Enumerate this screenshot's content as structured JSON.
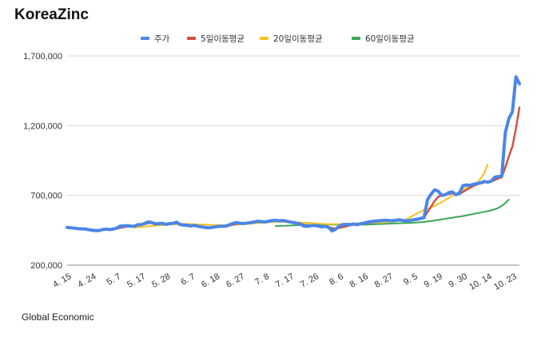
{
  "header": {
    "title": "KoreaZinc"
  },
  "footer": {
    "source": "Global Economic"
  },
  "colors": {
    "price": "#4a86e8",
    "ma5": "#d44b3f",
    "ma20": "#f4c21c",
    "ma60": "#3aa655",
    "grid": "#d9d9d9"
  },
  "chart_data": {
    "type": "line",
    "title": "KoreaZinc",
    "xlabel": "",
    "ylabel": "",
    "ylim": [
      200000,
      1700000
    ],
    "yticks": [
      200000,
      700000,
      1200000,
      1700000
    ],
    "ytick_labels": [
      "200,000",
      "700,000",
      "1,200,000",
      "1,700,000"
    ],
    "xticks": [
      {
        "i": 0,
        "label": "4. 15"
      },
      {
        "i": 7,
        "label": "4. 24"
      },
      {
        "i": 14,
        "label": "5. 7"
      },
      {
        "i": 21,
        "label": "5. 17"
      },
      {
        "i": 28,
        "label": "5. 28"
      },
      {
        "i": 35,
        "label": "6. 7"
      },
      {
        "i": 42,
        "label": "6. 18"
      },
      {
        "i": 49,
        "label": "6. 27"
      },
      {
        "i": 56,
        "label": "7. 8"
      },
      {
        "i": 63,
        "label": "7. 17"
      },
      {
        "i": 70,
        "label": "7. 26"
      },
      {
        "i": 77,
        "label": "8. 6"
      },
      {
        "i": 84,
        "label": "8. 16"
      },
      {
        "i": 91,
        "label": "8. 27"
      },
      {
        "i": 98,
        "label": "9. 5"
      },
      {
        "i": 105,
        "label": "9. 19"
      },
      {
        "i": 112,
        "label": "9. 30"
      },
      {
        "i": 119,
        "label": "10. 14"
      },
      {
        "i": 126,
        "label": "10. 23"
      }
    ],
    "legend_position": "top",
    "grid": true,
    "series": [
      {
        "name": "주가",
        "color": "#4a86e8",
        "start": 0,
        "width": 4,
        "values": [
          470000,
          468000,
          465000,
          462000,
          460000,
          460000,
          455000,
          450000,
          448000,
          448000,
          455000,
          458000,
          455000,
          458000,
          465000,
          480000,
          482000,
          483000,
          480000,
          478000,
          490000,
          490000,
          500000,
          510000,
          505000,
          495000,
          498000,
          500000,
          492000,
          498000,
          500000,
          508000,
          490000,
          487000,
          485000,
          480000,
          485000,
          478000,
          475000,
          470000,
          468000,
          470000,
          475000,
          478000,
          478000,
          480000,
          490000,
          500000,
          505000,
          500000,
          498000,
          502000,
          505000,
          510000,
          515000,
          512000,
          510000,
          515000,
          520000,
          522000,
          518000,
          520000,
          515000,
          510000,
          505000,
          500000,
          495000,
          480000,
          478000,
          482000,
          485000,
          480000,
          475000,
          478000,
          470000,
          445000,
          458000,
          480000,
          490000,
          492000,
          490000,
          495000,
          490000,
          496000,
          502000,
          508000,
          512000,
          515000,
          518000,
          520000,
          522000,
          520000,
          518000,
          522000,
          525000,
          520000,
          518000,
          520000,
          525000,
          530000,
          535000,
          540000,
          670000,
          710000,
          740000,
          730000,
          700000,
          705000,
          720000,
          725000,
          705000,
          715000,
          770000,
          775000,
          772000,
          780000,
          785000,
          790000,
          800000,
          795000,
          802000,
          830000,
          835000,
          840000,
          1150000,
          1250000,
          1300000,
          1550000,
          1500000
        ]
      },
      {
        "name": "5일이동평균",
        "color": "#d44b3f",
        "start": 0,
        "width": 2.4,
        "values": [
          468000,
          467000,
          465000,
          463000,
          461000,
          460000,
          457000,
          454000,
          452000,
          451000,
          453000,
          455000,
          456000,
          457000,
          460000,
          467000,
          472000,
          476000,
          479000,
          480000,
          484000,
          488000,
          494000,
          500000,
          502000,
          501000,
          500000,
          499000,
          497000,
          497000,
          498000,
          500000,
          496000,
          493000,
          490000,
          486000,
          484000,
          481000,
          478000,
          474000,
          472000,
          471000,
          472000,
          474000,
          476000,
          479000,
          484000,
          490000,
          496000,
          500000,
          501000,
          503000,
          505000,
          508000,
          512000,
          513000,
          513000,
          515000,
          518000,
          519000,
          518000,
          519000,
          516000,
          513000,
          509000,
          503000,
          497000,
          490000,
          485000,
          482000,
          481000,
          480000,
          478000,
          476000,
          473000,
          465000,
          462000,
          466000,
          472000,
          478000,
          485000,
          490000,
          492000,
          494000,
          497000,
          501000,
          506000,
          510000,
          514000,
          518000,
          520000,
          521000,
          521000,
          521000,
          521000,
          521000,
          520000,
          520000,
          521000,
          524000,
          530000,
          540000,
          580000,
          620000,
          660000,
          690000,
          700000,
          705000,
          710000,
          715000,
          710000,
          708000,
          725000,
          740000,
          755000,
          768000,
          778000,
          785000,
          792000,
          796000,
          798000,
          810000,
          822000,
          830000,
          900000,
          980000,
          1050000,
          1180000,
          1330000
        ]
      },
      {
        "name": "20일이동평균",
        "color": "#f4c21c",
        "start": 19,
        "width": 2,
        "values": [
          470000,
          471000,
          473000,
          476000,
          479000,
          481000,
          483000,
          485000,
          487000,
          488000,
          490000,
          492000,
          493000,
          494000,
          495000,
          495000,
          494000,
          493000,
          492000,
          491000,
          490000,
          489000,
          488000,
          487000,
          487000,
          487000,
          487000,
          488000,
          489000,
          490000,
          491000,
          493000,
          495000,
          497000,
          499000,
          501000,
          503000,
          505000,
          507000,
          509000,
          510000,
          510000,
          510000,
          510000,
          509000,
          508000,
          507000,
          506000,
          505000,
          504000,
          502000,
          500000,
          498000,
          496000,
          495000,
          494000,
          494000,
          494000,
          494000,
          495000,
          496000,
          497000,
          498000,
          499000,
          500000,
          501000,
          502000,
          503000,
          505000,
          507000,
          508000,
          509000,
          510000,
          512000,
          514000,
          516000,
          520000,
          530000,
          542000,
          556000,
          570000,
          583000,
          595000,
          605000,
          615000,
          625000,
          638000,
          652000,
          667000,
          682000,
          697000,
          712000,
          727000,
          742000,
          757000,
          765000,
          772000,
          790000,
          820000,
          860000,
          920000
        ]
      },
      {
        "name": "60일이동평균",
        "color": "#3aa655",
        "start": 59,
        "width": 2,
        "values": [
          480000,
          481000,
          482000,
          483000,
          484000,
          485000,
          486000,
          487000,
          488000,
          489000,
          489000,
          490000,
          490000,
          490000,
          490000,
          490000,
          490000,
          490000,
          490000,
          489000,
          489000,
          489000,
          489000,
          489000,
          490000,
          490000,
          491000,
          492000,
          493000,
          494000,
          495000,
          496000,
          497000,
          498000,
          499000,
          500000,
          501000,
          502000,
          503000,
          504000,
          506000,
          508000,
          510000,
          513000,
          516000,
          520000,
          524000,
          528000,
          532000,
          536000,
          540000,
          544000,
          548000,
          552000,
          557000,
          562000,
          567000,
          572000,
          577000,
          582000,
          587000,
          592000,
          600000,
          610000,
          625000,
          645000,
          670000
        ]
      }
    ]
  }
}
